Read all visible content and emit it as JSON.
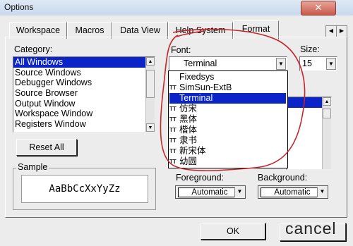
{
  "window": {
    "title": "Options",
    "close_label": "✕"
  },
  "tabs": [
    {
      "label": "Workspace"
    },
    {
      "label": "Macros"
    },
    {
      "label": "Data View"
    },
    {
      "label": "Help System"
    },
    {
      "label": "Format"
    }
  ],
  "tab_scroll": {
    "left": "◀",
    "right": "▶"
  },
  "category": {
    "label": "Category:",
    "items": [
      {
        "label": "All Windows",
        "selected": true
      },
      {
        "label": "Source Windows"
      },
      {
        "label": "Debugger Windows"
      },
      {
        "label": "Source Browser"
      },
      {
        "label": "Output Window"
      },
      {
        "label": "Workspace Window"
      },
      {
        "label": "Registers Window"
      }
    ]
  },
  "reset_button": "Reset All",
  "sample": {
    "label": "Sample",
    "text": "AaBbCcXxYyZz"
  },
  "font": {
    "label": "Font:",
    "value": "Terminal",
    "options": [
      {
        "label": "Fixedsys",
        "icon": ""
      },
      {
        "label": "SimSun-ExtB",
        "icon": "TT"
      },
      {
        "label": "Terminal",
        "icon": "",
        "selected": true
      },
      {
        "label": "仿宋",
        "icon": "TT"
      },
      {
        "label": "黑体",
        "icon": "TT"
      },
      {
        "label": "楷体",
        "icon": "TT"
      },
      {
        "label": "隶书",
        "icon": "TT"
      },
      {
        "label": "新宋体",
        "icon": "TT"
      },
      {
        "label": "幼圆",
        "icon": "TT"
      }
    ]
  },
  "size": {
    "label": "Size:",
    "value": "15"
  },
  "foreground": {
    "label": "Foreground:",
    "value": "Automatic"
  },
  "background": {
    "label": "Background:",
    "value": "Automatic"
  },
  "ok_button": "OK",
  "cancel_button": "cancel",
  "colors": {
    "selection": "#0a24c8",
    "annotation": "#c4262b"
  }
}
